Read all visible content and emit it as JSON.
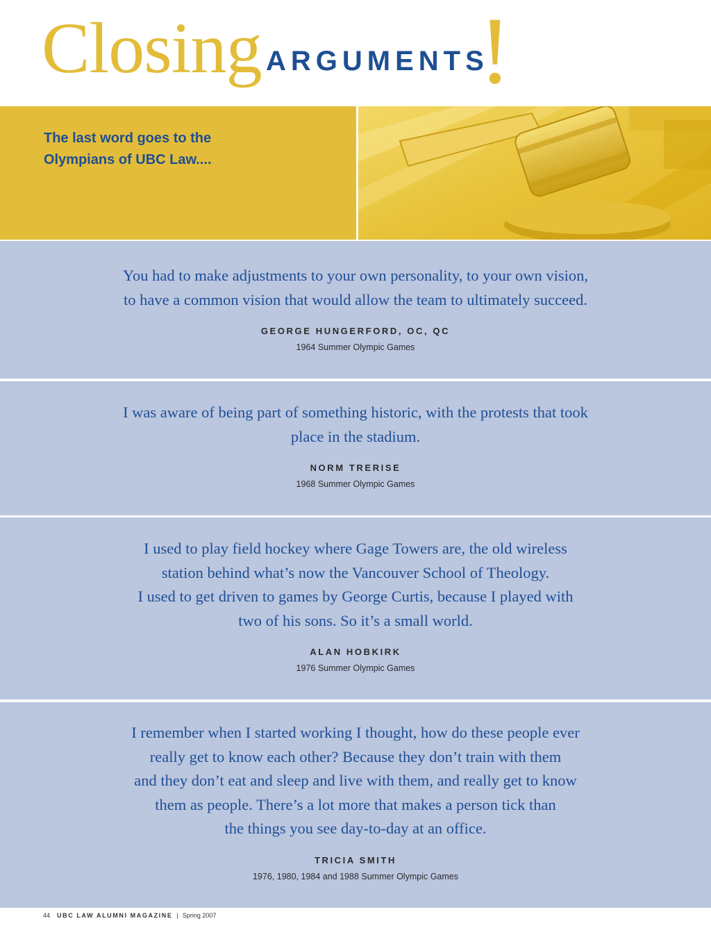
{
  "header": {
    "title_main": "Closing",
    "title_sub": "ARGUMENTS",
    "title_mark": "!"
  },
  "intro": {
    "line1": "The last word goes to the",
    "line2": "Olympians of UBC Law...."
  },
  "quotes": [
    {
      "text": "You had to make adjustments to your own personality, to your own vision,\nto have a common vision that would allow the team to ultimately succeed.",
      "name": "GEORGE HUNGERFORD, OC, QC",
      "games": "1964 Summer Olympic Games"
    },
    {
      "text": "I was aware of being part of something historic, with the protests that took\nplace in the stadium.",
      "name": "NORM TRERISE",
      "games": "1968 Summer Olympic Games"
    },
    {
      "text": "I used to play field hockey where Gage Towers are, the old wireless\nstation behind what’s now the Vancouver School of Theology.\nI used to get driven to games by George Curtis, because I played with\ntwo of his sons. So it’s a small world.",
      "name": "ALAN HOBKIRK",
      "games": "1976 Summer Olympic Games"
    },
    {
      "text": "I remember when I started working I thought, how do these people ever\nreally get to know each other? Because they don’t train with them\nand they don’t eat and sleep and live with them, and really get to know\nthem as people. There’s a lot more that makes a person tick than\nthe things you see day-to-day at an office.",
      "name": "TRICIA SMITH",
      "games": "1976, 1980, 1984 and 1988 Summer Olympic Games"
    }
  ],
  "footer": {
    "page_number": "44",
    "publication": "UBC LAW ALUMNI MAGAZINE",
    "separator": "|",
    "issue": "Spring 2007"
  },
  "colors": {
    "gold": "#e3bc3a",
    "blue": "#1e4f92",
    "panel": "#bbc6df"
  },
  "icons": {
    "gavel": "gavel-icon"
  }
}
